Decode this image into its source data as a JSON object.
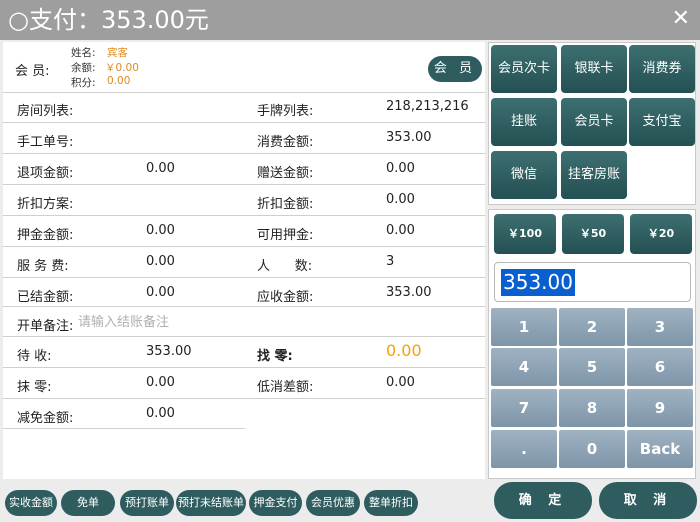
{
  "title": "○支付：353.00元",
  "close_icon": "close-icon",
  "member": {
    "label": "会 员:",
    "name_label": "姓名:",
    "name": "宾客",
    "balance_label": "余额:",
    "balance": "￥0.00",
    "points_label": "积分:",
    "points": "0.00",
    "button": "会 员"
  },
  "fields": {
    "room_list": "房间列表:",
    "tag_list": "手牌列表:",
    "tag_list_value": "218,213,216",
    "manual_no": "手工单号:",
    "consume_amount": "消费金额:",
    "consume_amount_value": "353.00",
    "refund_amount": "退项金额:",
    "refund_amount_value": "0.00",
    "gift_amount": "赠送金额:",
    "gift_amount_value": "0.00",
    "discount_plan": "折扣方案:",
    "discount_amount": "折扣金额:",
    "discount_amount_value": "0.00",
    "deposit_amount": "押金金额:",
    "deposit_amount_value": "0.00",
    "available_deposit": "可用押金:",
    "available_deposit_value": "0.00",
    "service_fee": "服 务 费:",
    "service_fee_value": "0.00",
    "people": "人      数:",
    "people_value": "3",
    "settled_amount": "已结金额:",
    "settled_amount_value": "0.00",
    "receivable": "应收金额:",
    "receivable_value": "353.00",
    "remark_label": "开单备注:",
    "remark_placeholder": "请输入结账备注",
    "pending": "待  收:",
    "pending_value": "353.00",
    "change": "找  零:",
    "change_value": "0.00",
    "rounding": "抹  零:",
    "rounding_value": "0.00",
    "min_diff": "低消差额:",
    "min_diff_value": "0.00",
    "waiver": "减免金额:",
    "waiver_value": "0.00"
  },
  "bottom_buttons": [
    "实收金额",
    "免单",
    "预打账单",
    "预打未结账单",
    "押金支付",
    "会员优惠",
    "整单折扣"
  ],
  "pay_methods": [
    "会员次卡",
    "银联卡",
    "消费券",
    "挂账",
    "会员卡",
    "支付宝",
    "微信",
    "挂客房账"
  ],
  "cash_buttons": [
    "￥100",
    "￥50",
    "￥20"
  ],
  "amount_value": "353.00",
  "keypad": [
    "1",
    "2",
    "3",
    "4",
    "5",
    "6",
    "7",
    "8",
    "9",
    ".",
    "0",
    "Back"
  ],
  "confirm": "确 定",
  "cancel": "取 消",
  "colors": {
    "accent": "#2f5d5f",
    "orange": "#e08a1e",
    "keypad": "#8ea3b6",
    "titlebar": "#9e9e9e"
  }
}
